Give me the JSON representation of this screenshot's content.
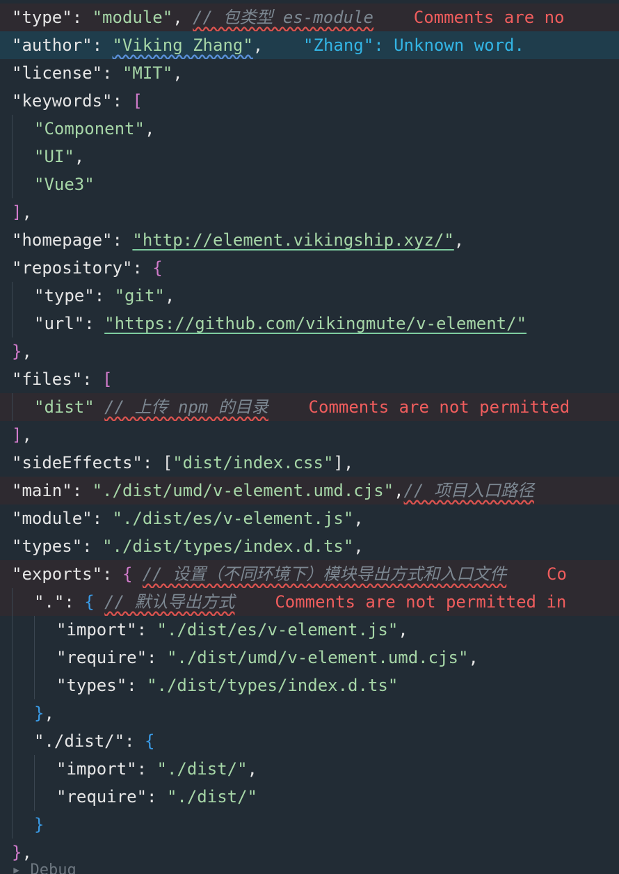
{
  "editor": {
    "lines": [
      {
        "key": "\"type\"",
        "value": "\"module\"",
        "comment": "// 包类型 es-module",
        "diagnostic": "Comments are no"
      },
      {
        "key": "\"author\"",
        "value": "\"Viking Zhang\"",
        "diagnostic": "\"Zhang\": Unknown word."
      },
      {
        "key": "\"license\"",
        "value": "\"MIT\""
      },
      {
        "key": "\"keywords\"",
        "open": "["
      },
      {
        "item": "\"Component\""
      },
      {
        "item": "\"UI\""
      },
      {
        "item": "\"Vue3\""
      },
      {
        "close": "]"
      },
      {
        "key": "\"homepage\"",
        "value": "\"http://element.vikingship.xyz/\""
      },
      {
        "key": "\"repository\"",
        "open": "{"
      },
      {
        "key": "\"type\"",
        "value": "\"git\""
      },
      {
        "key": "\"url\"",
        "value": "\"https://github.com/vikingmute/v-element/\""
      },
      {
        "close": "}"
      },
      {
        "key": "\"files\"",
        "open": "["
      },
      {
        "item": "\"dist\"",
        "comment": "// 上传 npm 的目录",
        "diagnostic": "Comments are not permitted"
      },
      {
        "close": "]"
      },
      {
        "key": "\"sideEffects\"",
        "open": "[",
        "item": "\"dist/index.css\"",
        "close": "]"
      },
      {
        "key": "\"main\"",
        "value": "\"./dist/umd/v-element.umd.cjs\"",
        "comment": "// 项目入口路径"
      },
      {
        "key": "\"module\"",
        "value": "\"./dist/es/v-element.js\""
      },
      {
        "key": "\"types\"",
        "value": "\"./dist/types/index.d.ts\""
      },
      {
        "key": "\"exports\"",
        "open": "{",
        "comment": "// 设置（不同环境下）模块导出方式和入口文件",
        "diagnostic": "Co"
      },
      {
        "key": "\".\"",
        "open": "{",
        "comment": "// 默认导出方式",
        "diagnostic": "Comments are not permitted in"
      },
      {
        "key": "\"import\"",
        "value": "\"./dist/es/v-element.js\""
      },
      {
        "key": "\"require\"",
        "value": "\"./dist/umd/v-element.umd.cjs\""
      },
      {
        "key": "\"types\"",
        "value": "\"./dist/types/index.d.ts\""
      },
      {
        "close": "}"
      },
      {
        "key": "\"./dist/\"",
        "open": "{"
      },
      {
        "key": "\"import\"",
        "value": "\"./dist/\""
      },
      {
        "key": "\"require\"",
        "value": "\"./dist/\""
      },
      {
        "close": "}"
      },
      {
        "close": "}"
      }
    ],
    "partial_next_line": "Debug"
  }
}
